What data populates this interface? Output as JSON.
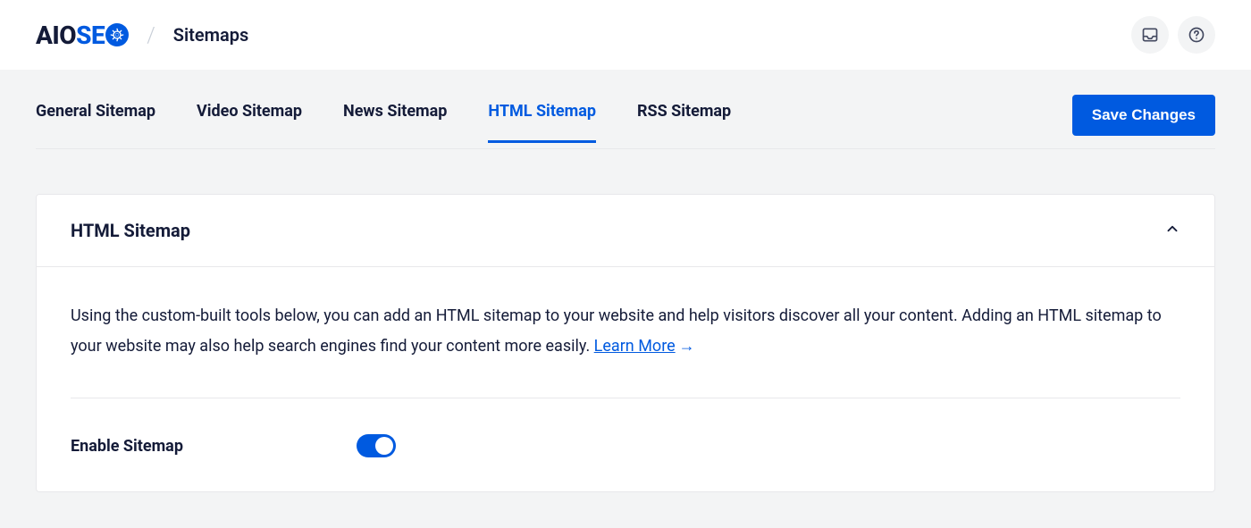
{
  "header": {
    "logo_prefix": "AIO",
    "logo_suffix": "SE",
    "page_title": "Sitemaps"
  },
  "tabs": [
    {
      "label": "General Sitemap",
      "active": false
    },
    {
      "label": "Video Sitemap",
      "active": false
    },
    {
      "label": "News Sitemap",
      "active": false
    },
    {
      "label": "HTML Sitemap",
      "active": true
    },
    {
      "label": "RSS Sitemap",
      "active": false
    }
  ],
  "save_button": "Save Changes",
  "card": {
    "title": "HTML Sitemap",
    "description": "Using the custom-built tools below, you can add an HTML sitemap to your website and help visitors discover all your content. Adding an HTML sitemap to your website may also help search engines find your content more easily. ",
    "learn_more": "Learn More"
  },
  "settings": {
    "enable_label": "Enable Sitemap",
    "enable_value": true
  }
}
